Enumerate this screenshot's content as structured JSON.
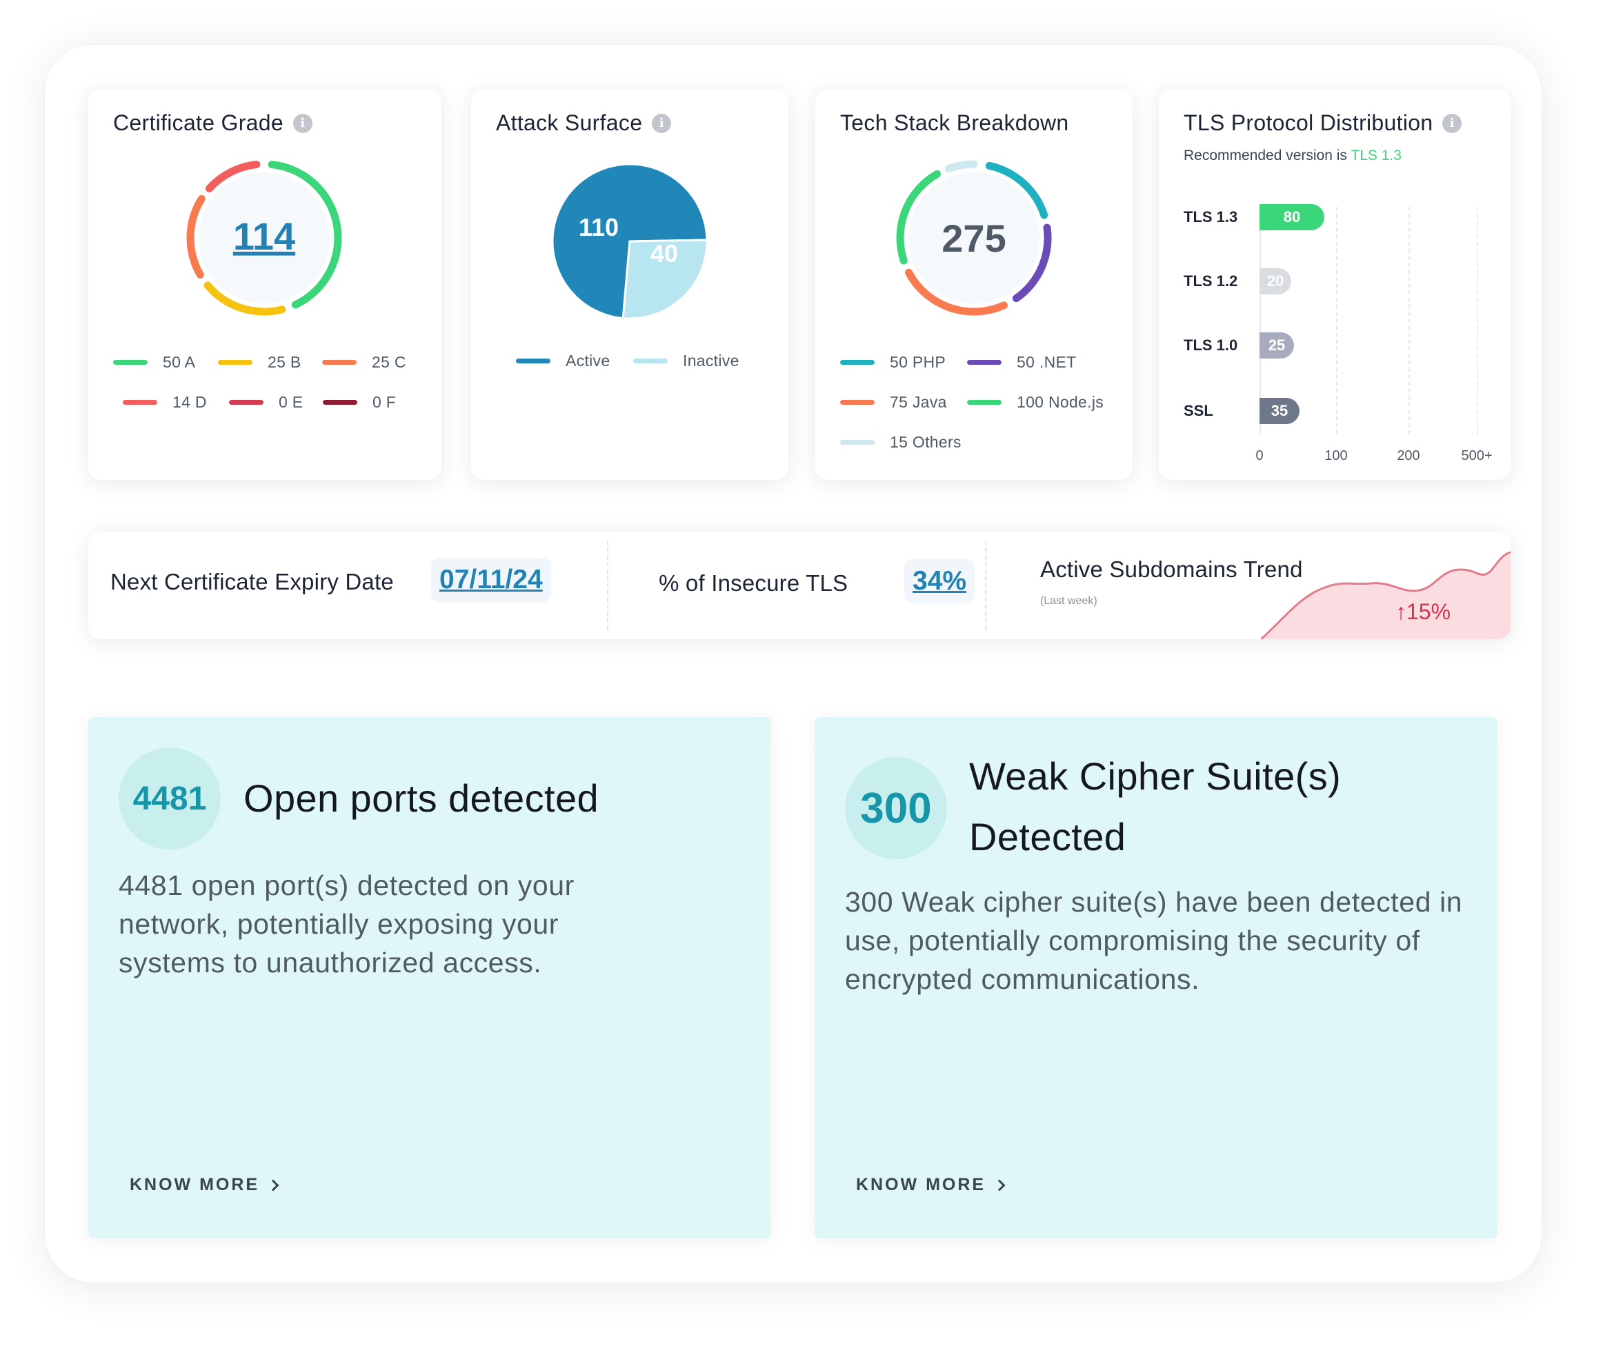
{
  "cert_grade": {
    "title": "Certificate Grade",
    "total": "114",
    "legend": [
      {
        "label": "50 A",
        "color": "#3cd67a"
      },
      {
        "label": "25 B",
        "color": "#f5c30f"
      },
      {
        "label": "25 C",
        "color": "#fa7a50"
      },
      {
        "label": "14 D",
        "color": "#f25d5d"
      },
      {
        "label": "0 E",
        "color": "#d23c50"
      },
      {
        "label": "0 F",
        "color": "#8f1c33"
      }
    ]
  },
  "attack_surface": {
    "title": "Attack Surface",
    "active_value": "110",
    "inactive_value": "40",
    "legend": [
      {
        "label": "Active",
        "color": "#2087b8"
      },
      {
        "label": "Inactive",
        "color": "#b7e6f0"
      }
    ]
  },
  "tech_stack": {
    "title": "Tech Stack Breakdown",
    "total": "275",
    "legend": [
      {
        "label": "50 PHP",
        "color": "#1fb1c1"
      },
      {
        "label": "50 .NET",
        "color": "#6a4bb8"
      },
      {
        "label": "75 Java",
        "color": "#fa7a50"
      },
      {
        "label": "100 Node.js",
        "color": "#3cd67a"
      },
      {
        "label": "15 Others",
        "color": "#cde8ee"
      }
    ]
  },
  "tls": {
    "title": "TLS Protocol Distribution",
    "subtitle_prefix": "Recommended version is",
    "subtitle_highlight": "TLS 1.3",
    "highlight_color": "#3cd67a",
    "rows": [
      {
        "label": "TLS 1.3",
        "value": "80",
        "color": "#3cd67a"
      },
      {
        "label": "TLS 1.2",
        "value": "20",
        "color": "#d9dce1"
      },
      {
        "label": "TLS 1.0",
        "value": "25",
        "color": "#a6acbb"
      },
      {
        "label": "SSL",
        "value": "35",
        "color": "#6f778a"
      }
    ],
    "ticks": [
      "0",
      "100",
      "200",
      "500+"
    ]
  },
  "metrics": {
    "expiry_label": "Next Certificate Expiry Date",
    "expiry_value": "07/11/24",
    "insecure_label": "% of Insecure TLS",
    "insecure_value": "34%",
    "trend_title": "Active Subdomains Trend",
    "trend_period": "(Last week)",
    "trend_change": "15%",
    "trend_arrow": "↑",
    "trend_color": "#d9304c"
  },
  "alerts": [
    {
      "count": "4481",
      "title": "Open ports detected",
      "description": "4481 open port(s) detected on your network, potentially exposing your systems to unauthorized access.",
      "link": "KNOW MORE"
    },
    {
      "count": "300",
      "title_line1": "Weak Cipher Suite(s)",
      "title_line2": "Detected",
      "description": "300 Weak cipher suite(s) have been detected in use, potentially compromising the security of encrypted communications.",
      "link": "KNOW MORE"
    }
  ]
}
